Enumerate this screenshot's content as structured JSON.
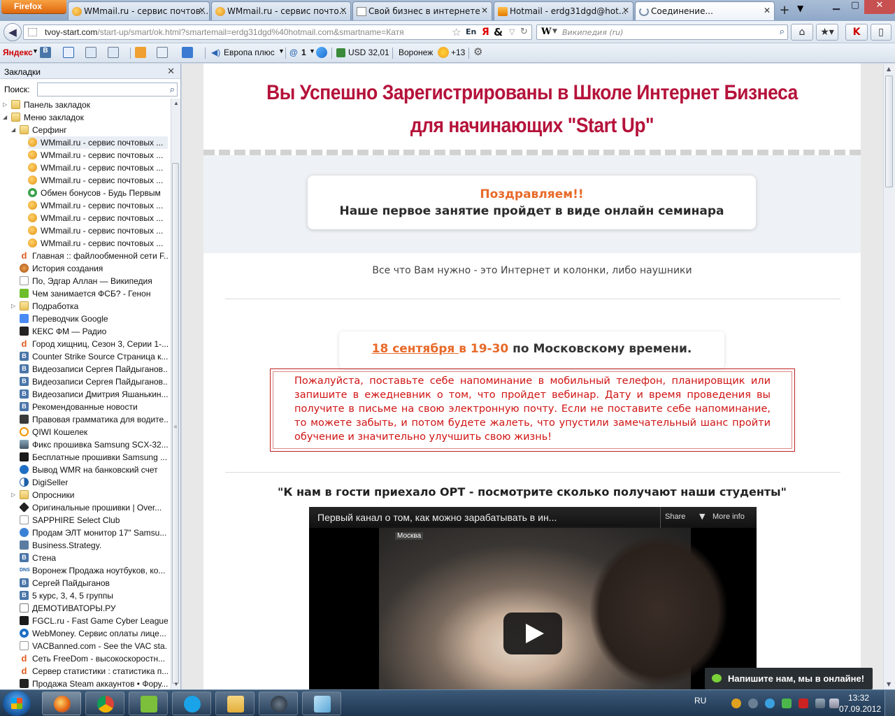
{
  "browser": {
    "menu_button": "Firefox",
    "tabs": [
      {
        "title": "WMmail.ru - сервис почтов..."
      },
      {
        "title": "WMmail.ru - сервис почто..."
      },
      {
        "title": "Свой бизнес в интернете"
      },
      {
        "title": "Hotmail - erdg31dgd@hot..."
      },
      {
        "title": "Соединение..."
      }
    ],
    "new_tab": "+",
    "url_domain": "tvoy-start.com",
    "url_path": "/start-up/smart/ok.html?smartemail=erdg31dgd%40hotmail.com&smartname=Катя",
    "url_en": "En",
    "url_ya": "Я",
    "url_amp": "&",
    "search_engine": "W",
    "search_placeholder": "Википедия (ru)"
  },
  "yandex_toolbar": {
    "logo": "Яндекс",
    "radio": "Европа плюс",
    "mail_count": "1",
    "currency": "USD 32,01",
    "city": "Воронеж",
    "weather": "+13"
  },
  "sidebar": {
    "title": "Закладки",
    "search_label": "Поиск:",
    "items": [
      {
        "label": "Панель закладок",
        "kind": "folder"
      },
      {
        "label": "Меню закладок",
        "kind": "folder"
      },
      {
        "label": "Серфинг",
        "kind": "folder"
      },
      {
        "label": "WMmail.ru - сервис почтовых ...",
        "kind": "wm"
      },
      {
        "label": "WMmail.ru - сервис почтовых ...",
        "kind": "wm"
      },
      {
        "label": "WMmail.ru - сервис почтовых ...",
        "kind": "wm"
      },
      {
        "label": "WMmail.ru - сервис почтовых ...",
        "kind": "wm"
      },
      {
        "label": "Обмен бонусов - Будь Первым",
        "kind": "bonus"
      },
      {
        "label": "WMmail.ru - сервис почтовых ...",
        "kind": "wm"
      },
      {
        "label": "WMmail.ru - сервис почтовых ...",
        "kind": "wm"
      },
      {
        "label": "WMmail.ru - сервис почтовых ...",
        "kind": "wm"
      },
      {
        "label": "WMmail.ru - сервис почтовых ...",
        "kind": "wm"
      },
      {
        "label": "Главная :: файлообменной сети F...",
        "kind": "d"
      },
      {
        "label": "История создания",
        "kind": "hist"
      },
      {
        "label": "По, Эдгар Аллан — Википедия",
        "kind": "blank"
      },
      {
        "label": "Чем занимается ФСБ? - Генон",
        "kind": "green"
      },
      {
        "label": "Подработка",
        "kind": "folder"
      },
      {
        "label": "Переводчик Google",
        "kind": "google"
      },
      {
        "label": "КЕКС ФМ — Радио",
        "kind": "keks"
      },
      {
        "label": "Город хищниц, Сезон 3, Серии 1-...",
        "kind": "d"
      },
      {
        "label": "Counter Strike Source  Страница к...",
        "kind": "vk"
      },
      {
        "label": "Видеозаписи Сергея Пайдыганов...",
        "kind": "vk"
      },
      {
        "label": "Видеозаписи Сергея Пайдыганов...",
        "kind": "vk"
      },
      {
        "label": "Видеозаписи Дмитрия Яшанькин...",
        "kind": "vk"
      },
      {
        "label": "Рекомендованные новости",
        "kind": "vk"
      },
      {
        "label": "Правовая грамматика для водите...",
        "kind": "law"
      },
      {
        "label": "QIWI Кошелек",
        "kind": "qiwi"
      },
      {
        "label": "Фикс прошивка Samsung SCX-32...",
        "kind": "samsung"
      },
      {
        "label": "Бесплатные прошивки Samsung ...",
        "kind": "book"
      },
      {
        "label": "Вывод WMR на банковский счет",
        "kind": "wmr"
      },
      {
        "label": "DigiSeller",
        "kind": "digi"
      },
      {
        "label": "Опросники",
        "kind": "folder"
      },
      {
        "label": "Оригинальные прошивки | Over...",
        "kind": "over"
      },
      {
        "label": "SAPPHIRE Select Club",
        "kind": "blank"
      },
      {
        "label": "Продам ЭЛТ монитор 17\" Samsu...",
        "kind": "chat"
      },
      {
        "label": "Business.Strategy.",
        "kind": "biz"
      },
      {
        "label": "Стена",
        "kind": "vk"
      },
      {
        "label": "Воронеж Продажа ноутбуков, ко...",
        "kind": "dns"
      },
      {
        "label": "Сергей Пайдыганов",
        "kind": "vk"
      },
      {
        "label": "5 курс, 3, 4, 5 группы",
        "kind": "vk"
      },
      {
        "label": "ДЕМОТИВАТОРЫ.РУ",
        "kind": "demot"
      },
      {
        "label": "FGCL.ru - Fast Game Cyber League",
        "kind": "fgcl"
      },
      {
        "label": "WebMoney. Сервис оплаты лице...",
        "kind": "webmoney"
      },
      {
        "label": "VACBanned.com - See the VAC sta...",
        "kind": "blank"
      },
      {
        "label": "Сеть FreeDom - высокоскоростн...",
        "kind": "d"
      },
      {
        "label": "Сервер статистики : статистика п...",
        "kind": "d"
      },
      {
        "label": "Продажа Steam аккаунтов • Фору...",
        "kind": "steam"
      }
    ]
  },
  "page": {
    "headline_1": "Вы Успешно Зарегистрированы в Школе Интернет Бизнеса",
    "headline_2": "для начинающих \"Start Up\"",
    "congrats_title": "Поздравляем!!",
    "congrats_text": "Наше первое занятие пройдет в виде онлайн семинара",
    "need_text": "Все что Вам нужно - это Интернет и колонки, либо наушники",
    "date_link": "18 сентября ",
    "date_time": "в 19-30",
    "date_suffix": " по Московскому времени.",
    "reminder": "Пожалуйста, поставьте себе напоминание в мобильный телефон, планировщик или запишите в ежедневник о том, что пройдет вебинар. Дату и время проведения вы получите в письме на свою электронную почту. Если не поставите себе напоминание, то можете забыть, и потом будете жалеть, что упустили замечательный шанс пройти обучение и значительно улучшить свою жизнь!",
    "ort_heading": "\"К нам в гости приехало ОРТ - посмотрите сколько получают наши студенты\"",
    "video_title": "Первый канал о том, как можно зарабатывать в ин...",
    "video_share": "Share",
    "video_more": "More info",
    "video_channel_logo": "Москва",
    "chat_button": "Напишите нам, мы в онлайне!"
  },
  "taskbar": {
    "lang": "RU",
    "time": "13:32",
    "date": "07.09.2012"
  },
  "colors": {
    "headline": "#b5123a",
    "accent_orange": "#e86a2a",
    "reminder_red": "#d01414"
  }
}
